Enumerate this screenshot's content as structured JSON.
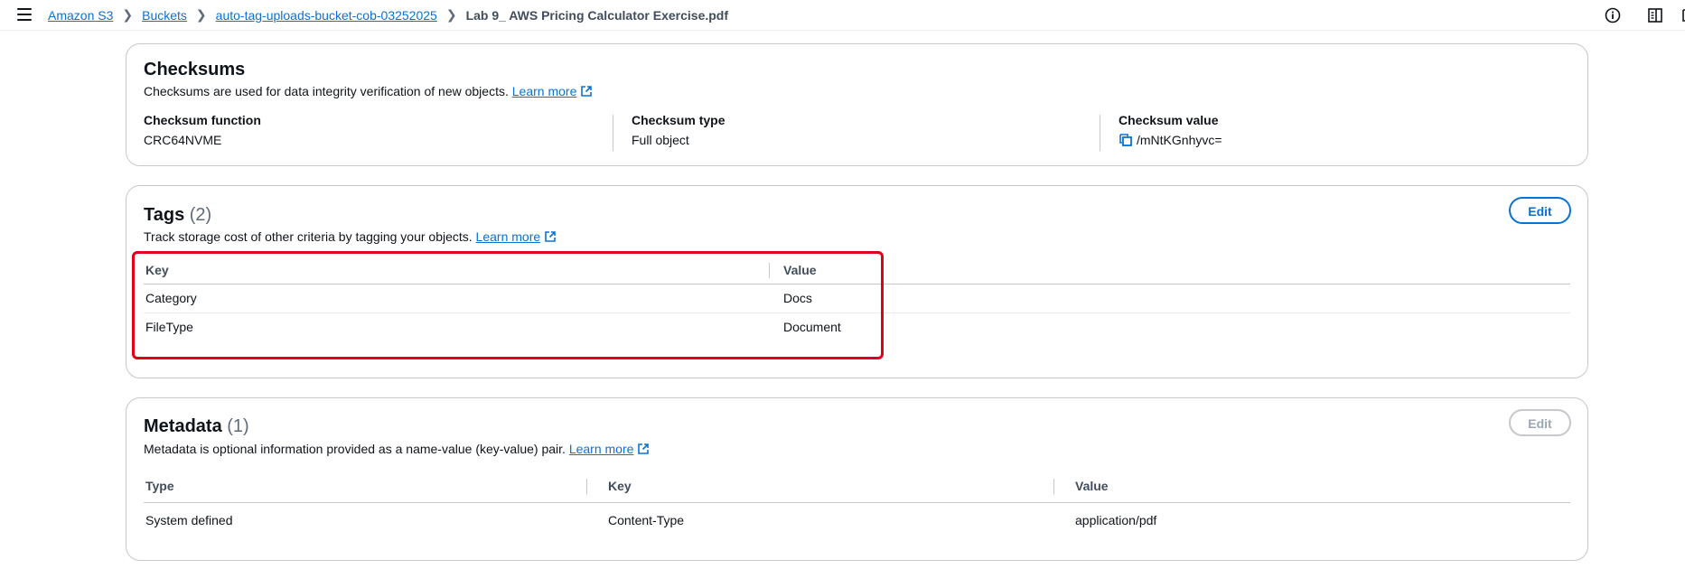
{
  "breadcrumb": {
    "items": [
      "Amazon S3",
      "Buckets",
      "auto-tag-uploads-bucket-cob-03252025"
    ],
    "current": "Lab 9_ AWS Pricing Calculator Exercise.pdf"
  },
  "checksums": {
    "title": "Checksums",
    "description": "Checksums are used for data integrity verification of new objects.",
    "learn_more": "Learn more",
    "fields": [
      {
        "label": "Checksum function",
        "value": "CRC64NVME"
      },
      {
        "label": "Checksum type",
        "value": "Full object"
      },
      {
        "label": "Checksum value",
        "value": "/mNtKGnhyvc="
      }
    ]
  },
  "tags": {
    "title": "Tags",
    "count": "(2)",
    "description": "Track storage cost of other criteria by tagging your objects.",
    "learn_more": "Learn more",
    "edit_label": "Edit",
    "columns": [
      "Key",
      "Value"
    ],
    "rows": [
      {
        "key": "Category",
        "value": "Docs"
      },
      {
        "key": "FileType",
        "value": "Document"
      }
    ]
  },
  "metadata": {
    "title": "Metadata",
    "count": "(1)",
    "description": "Metadata is optional information provided as a name-value (key-value) pair.",
    "learn_more": "Learn more",
    "edit_label": "Edit",
    "columns": [
      "Type",
      "Key",
      "Value"
    ],
    "rows": [
      {
        "type": "System defined",
        "key": "Content-Type",
        "value": "application/pdf"
      }
    ]
  },
  "icons": {
    "menu": "hamburger-menu-icon",
    "info": "info-icon",
    "panel": "side-panel-icon",
    "external": "external-link-icon",
    "copy": "copy-icon",
    "separator": "chevron-right-icon"
  },
  "colors": {
    "link": "#0972d3",
    "highlight": "#e0001a",
    "border": "#c6c6cd"
  }
}
